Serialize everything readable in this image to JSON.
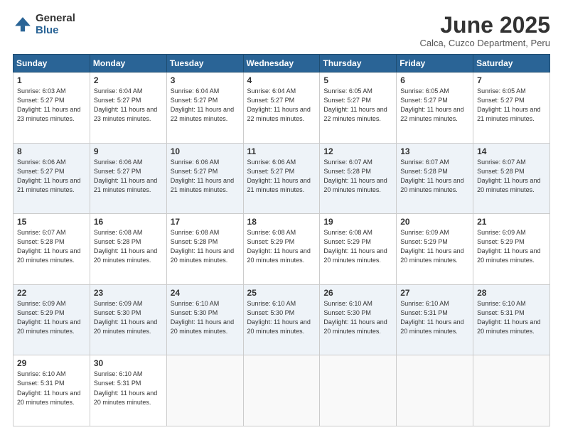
{
  "logo": {
    "general": "General",
    "blue": "Blue"
  },
  "header": {
    "month": "June 2025",
    "location": "Calca, Cuzco Department, Peru"
  },
  "days_of_week": [
    "Sunday",
    "Monday",
    "Tuesday",
    "Wednesday",
    "Thursday",
    "Friday",
    "Saturday"
  ],
  "weeks": [
    [
      {
        "day": 1,
        "sunrise": "6:03 AM",
        "sunset": "5:27 PM",
        "daylight": "11 hours and 23 minutes"
      },
      {
        "day": 2,
        "sunrise": "6:04 AM",
        "sunset": "5:27 PM",
        "daylight": "11 hours and 23 minutes"
      },
      {
        "day": 3,
        "sunrise": "6:04 AM",
        "sunset": "5:27 PM",
        "daylight": "11 hours and 22 minutes"
      },
      {
        "day": 4,
        "sunrise": "6:04 AM",
        "sunset": "5:27 PM",
        "daylight": "11 hours and 22 minutes"
      },
      {
        "day": 5,
        "sunrise": "6:05 AM",
        "sunset": "5:27 PM",
        "daylight": "11 hours and 22 minutes"
      },
      {
        "day": 6,
        "sunrise": "6:05 AM",
        "sunset": "5:27 PM",
        "daylight": "11 hours and 22 minutes"
      },
      {
        "day": 7,
        "sunrise": "6:05 AM",
        "sunset": "5:27 PM",
        "daylight": "11 hours and 21 minutes"
      }
    ],
    [
      {
        "day": 8,
        "sunrise": "6:06 AM",
        "sunset": "5:27 PM",
        "daylight": "11 hours and 21 minutes"
      },
      {
        "day": 9,
        "sunrise": "6:06 AM",
        "sunset": "5:27 PM",
        "daylight": "11 hours and 21 minutes"
      },
      {
        "day": 10,
        "sunrise": "6:06 AM",
        "sunset": "5:27 PM",
        "daylight": "11 hours and 21 minutes"
      },
      {
        "day": 11,
        "sunrise": "6:06 AM",
        "sunset": "5:27 PM",
        "daylight": "11 hours and 21 minutes"
      },
      {
        "day": 12,
        "sunrise": "6:07 AM",
        "sunset": "5:28 PM",
        "daylight": "11 hours and 20 minutes"
      },
      {
        "day": 13,
        "sunrise": "6:07 AM",
        "sunset": "5:28 PM",
        "daylight": "11 hours and 20 minutes"
      },
      {
        "day": 14,
        "sunrise": "6:07 AM",
        "sunset": "5:28 PM",
        "daylight": "11 hours and 20 minutes"
      }
    ],
    [
      {
        "day": 15,
        "sunrise": "6:07 AM",
        "sunset": "5:28 PM",
        "daylight": "11 hours and 20 minutes"
      },
      {
        "day": 16,
        "sunrise": "6:08 AM",
        "sunset": "5:28 PM",
        "daylight": "11 hours and 20 minutes"
      },
      {
        "day": 17,
        "sunrise": "6:08 AM",
        "sunset": "5:28 PM",
        "daylight": "11 hours and 20 minutes"
      },
      {
        "day": 18,
        "sunrise": "6:08 AM",
        "sunset": "5:29 PM",
        "daylight": "11 hours and 20 minutes"
      },
      {
        "day": 19,
        "sunrise": "6:08 AM",
        "sunset": "5:29 PM",
        "daylight": "11 hours and 20 minutes"
      },
      {
        "day": 20,
        "sunrise": "6:09 AM",
        "sunset": "5:29 PM",
        "daylight": "11 hours and 20 minutes"
      },
      {
        "day": 21,
        "sunrise": "6:09 AM",
        "sunset": "5:29 PM",
        "daylight": "11 hours and 20 minutes"
      }
    ],
    [
      {
        "day": 22,
        "sunrise": "6:09 AM",
        "sunset": "5:29 PM",
        "daylight": "11 hours and 20 minutes"
      },
      {
        "day": 23,
        "sunrise": "6:09 AM",
        "sunset": "5:30 PM",
        "daylight": "11 hours and 20 minutes"
      },
      {
        "day": 24,
        "sunrise": "6:10 AM",
        "sunset": "5:30 PM",
        "daylight": "11 hours and 20 minutes"
      },
      {
        "day": 25,
        "sunrise": "6:10 AM",
        "sunset": "5:30 PM",
        "daylight": "11 hours and 20 minutes"
      },
      {
        "day": 26,
        "sunrise": "6:10 AM",
        "sunset": "5:30 PM",
        "daylight": "11 hours and 20 minutes"
      },
      {
        "day": 27,
        "sunrise": "6:10 AM",
        "sunset": "5:31 PM",
        "daylight": "11 hours and 20 minutes"
      },
      {
        "day": 28,
        "sunrise": "6:10 AM",
        "sunset": "5:31 PM",
        "daylight": "11 hours and 20 minutes"
      }
    ],
    [
      {
        "day": 29,
        "sunrise": "6:10 AM",
        "sunset": "5:31 PM",
        "daylight": "11 hours and 20 minutes"
      },
      {
        "day": 30,
        "sunrise": "6:10 AM",
        "sunset": "5:31 PM",
        "daylight": "11 hours and 20 minutes"
      },
      null,
      null,
      null,
      null,
      null
    ]
  ]
}
